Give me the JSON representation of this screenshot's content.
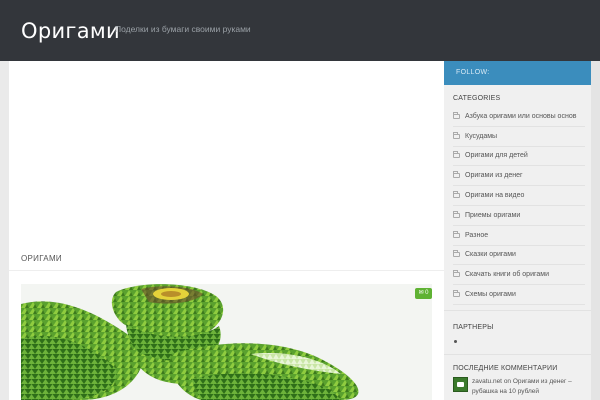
{
  "header": {
    "site_title": "Оригами",
    "tagline": "Поделки из бумаги своими руками"
  },
  "main": {
    "section_heading": "ОРИГАМИ",
    "post": {
      "comment_count": "0"
    }
  },
  "sidebar": {
    "follow_label": "FOLLOW:",
    "categories_title": "CATEGORIES",
    "categories": [
      "Азбука оригами или основы основ",
      "Кусудамы",
      "Оригами для детей",
      "Оригами из денег",
      "Оригами на видео",
      "Приемы оригами",
      "Разное",
      "Сказки оригами",
      "Скачать книги об оригами",
      "Схемы оригами"
    ],
    "partners_title": "ПАРТНЕРЫ",
    "recent_comments_title": "ПОСЛЕДНИЕ КОММЕНТАРИИ",
    "recent_comment": {
      "author": "zavatu.net",
      "on_word": "on",
      "post_title": "Оригами из денег – рубашка на 10 рублей"
    }
  },
  "colors": {
    "header_bg": "#33363b",
    "follow_bg": "#3b8dbd",
    "badge_green": "#5fb233"
  }
}
